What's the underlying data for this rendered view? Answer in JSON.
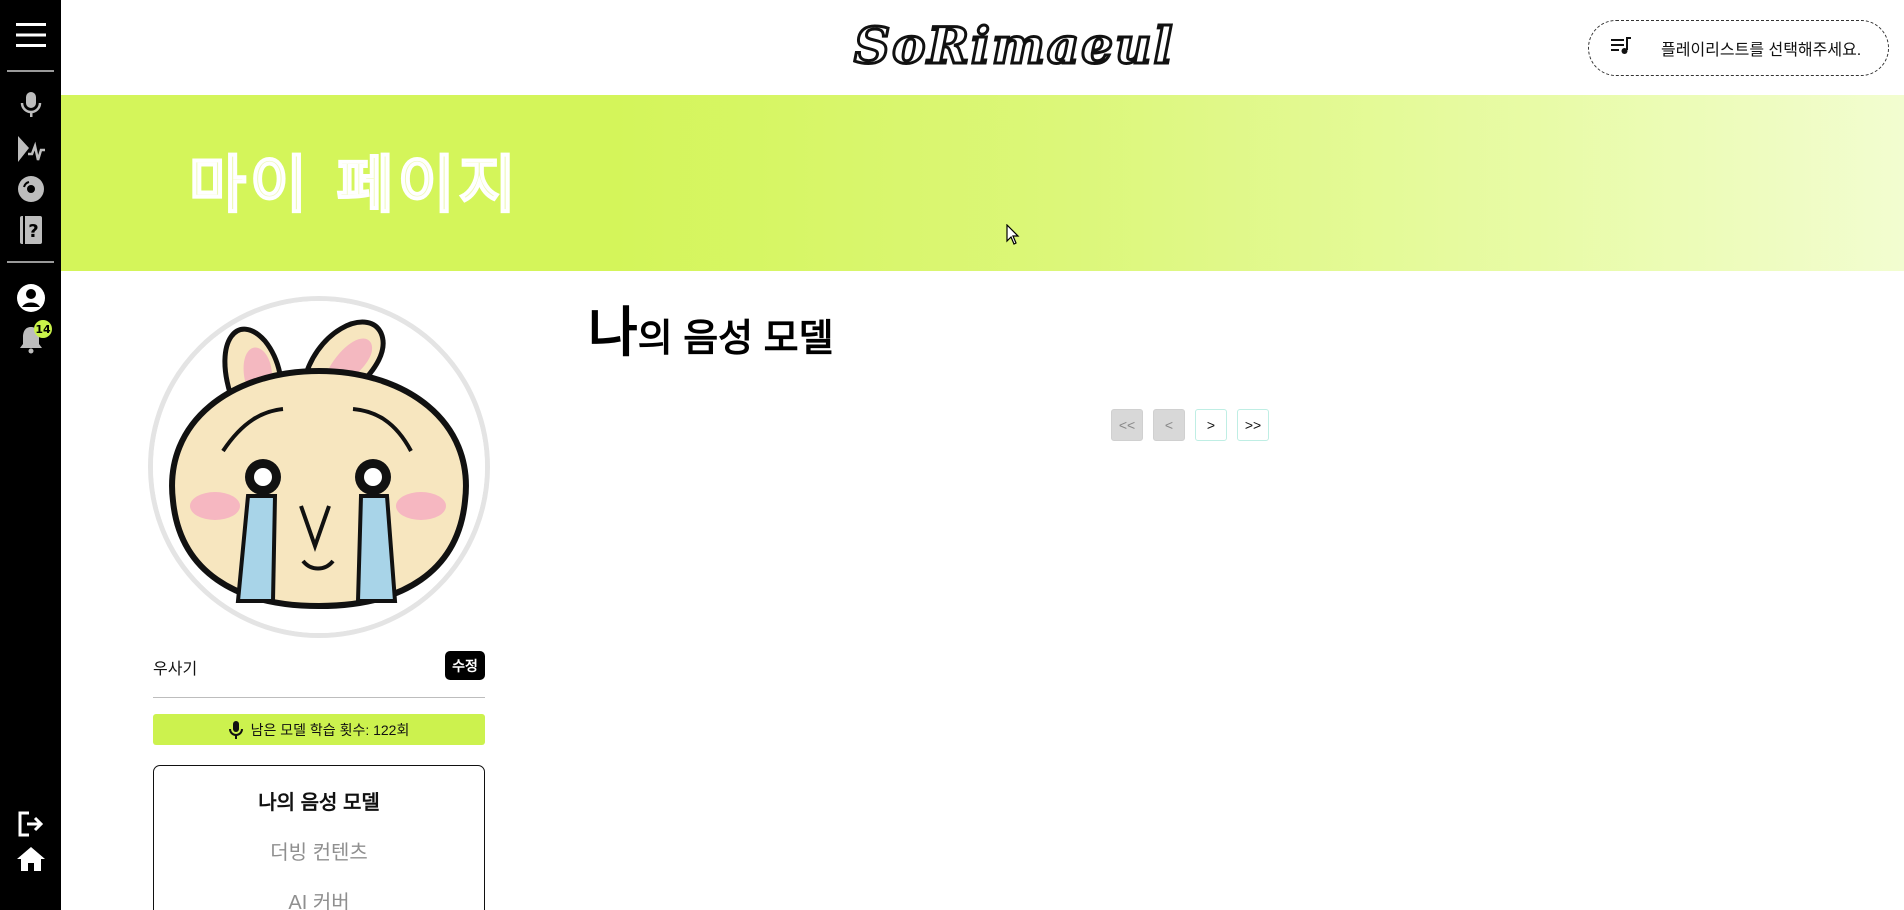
{
  "app": {
    "logo_text": "SoRimaeul"
  },
  "header": {
    "playlist_label": "플레이리스트를 선택해주세요."
  },
  "banner": {
    "title": "마이 페이지"
  },
  "sidebar_rail": {
    "icons": [
      "menu-icon",
      "microphone-icon",
      "voice-wave-icon",
      "disc-icon",
      "help-book-icon",
      "user-profile-icon",
      "bell-icon",
      "logout-icon",
      "home-icon"
    ],
    "notification_count": "14"
  },
  "profile": {
    "username": "우사기",
    "edit_label": "수정",
    "remaining_label": "남은 모델 학습 횟수: 122회"
  },
  "profile_menu": {
    "items": [
      {
        "label": "나의 음성 모델",
        "active": true
      },
      {
        "label": "더빙 컨텐츠",
        "active": false
      },
      {
        "label": "AI 커버",
        "active": false
      }
    ]
  },
  "main": {
    "title_first": "나",
    "title_rest": "의 음성 모델"
  },
  "pagination": {
    "first": "<<",
    "prev": "<",
    "next": ">",
    "last": ">>"
  },
  "colors": {
    "accent": "#ccf24e",
    "rail": "#000000",
    "banner_start": "#d4f55a",
    "banner_end": "#f2fdd0"
  }
}
